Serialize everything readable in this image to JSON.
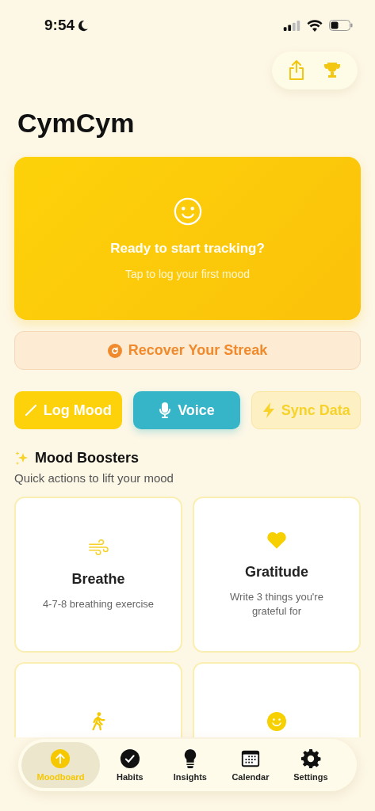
{
  "status_bar": {
    "time": "9:54"
  },
  "title": "CymCym",
  "hero": {
    "title": "Ready to start tracking?",
    "subtitle": "Tap to log your first mood"
  },
  "recover": {
    "label": "Recover Your Streak"
  },
  "actions": [
    {
      "label": "Log Mood",
      "kind": "log"
    },
    {
      "label": "Voice",
      "kind": "voice"
    },
    {
      "label": "Sync Data",
      "kind": "sync"
    }
  ],
  "boosters": {
    "title": "Mood Boosters",
    "subtitle": "Quick actions to lift your mood",
    "cards": [
      {
        "kind": "breathe",
        "title": "Breathe",
        "description": "4-7-8 breathing exercise"
      },
      {
        "kind": "gratitude",
        "title": "Gratitude",
        "description": "Write 3 things you're grateful for"
      },
      {
        "kind": "walk"
      },
      {
        "kind": "laugh"
      }
    ]
  },
  "tab_bar": [
    {
      "label": "Moodboard",
      "kind": "moodboard",
      "selected": true
    },
    {
      "label": "Habits",
      "kind": "habits",
      "selected": false
    },
    {
      "label": "Insights",
      "kind": "insights",
      "selected": false
    },
    {
      "label": "Calendar",
      "kind": "calendar",
      "selected": false
    },
    {
      "label": "Settings",
      "kind": "settings",
      "selected": false
    }
  ]
}
